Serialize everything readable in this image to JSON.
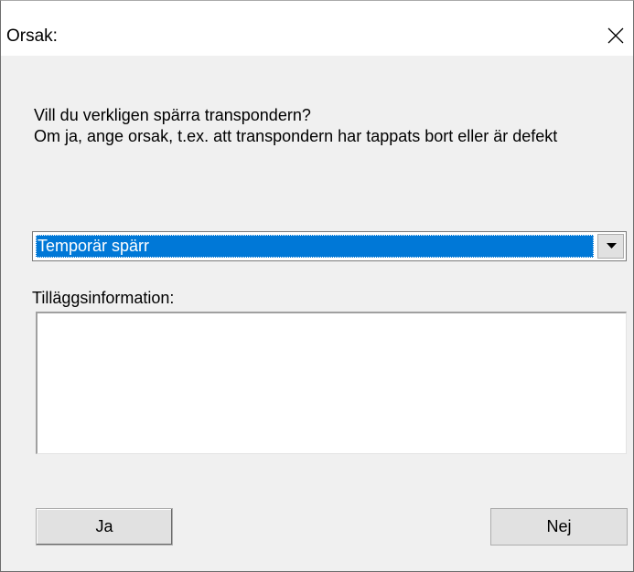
{
  "dialog": {
    "title": "Orsak:",
    "close_icon": "close-icon"
  },
  "message": "Vill du verkligen spärra transpondern?\nOm ja, ange orsak, t.ex. att transpondern har tappats bort eller är defekt",
  "reason_select": {
    "selected_value": "Temporär spärr",
    "arrow_icon": "chevron-down-icon"
  },
  "additional_info": {
    "label": "Tilläggsinformation:",
    "value": ""
  },
  "buttons": {
    "yes_label": "Ja",
    "no_label": "Nej"
  },
  "colors": {
    "selection": "#0078d7",
    "dialog_bg": "#f0f0f0",
    "titlebar_bg": "#ffffff"
  }
}
